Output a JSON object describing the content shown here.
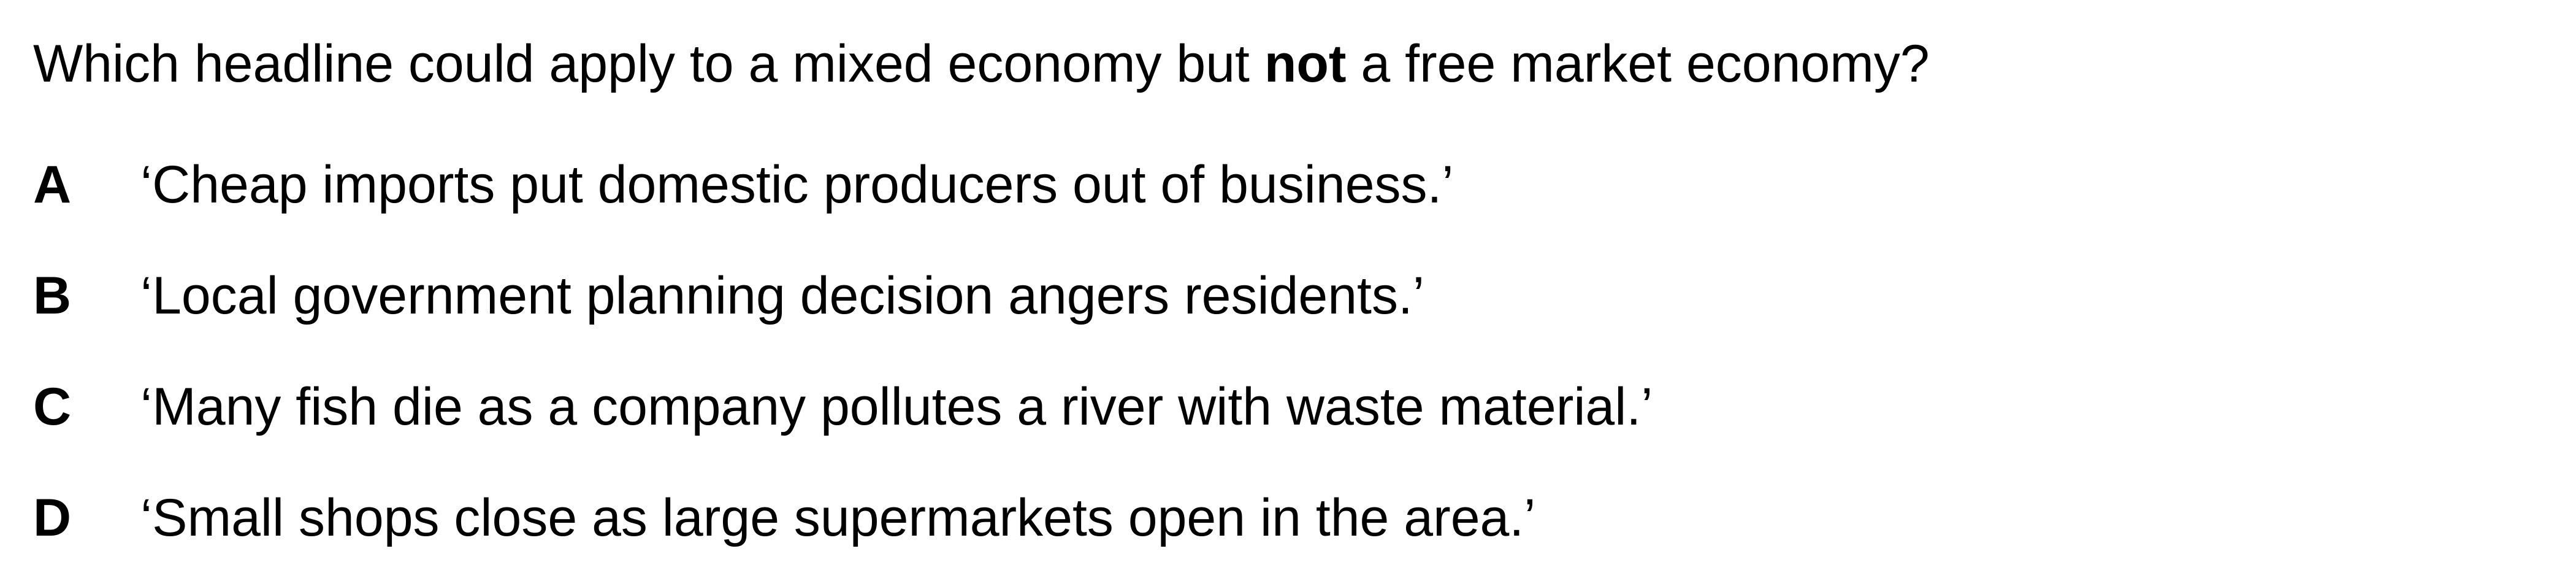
{
  "question": {
    "prefix": "Which headline could apply to a mixed economy but ",
    "emphasis": "not",
    "suffix": " a free market economy?"
  },
  "options": [
    {
      "letter": "A",
      "text": "‘Cheap imports put domestic producers out of business.’"
    },
    {
      "letter": "B",
      "text": "‘Local government planning decision angers residents.’"
    },
    {
      "letter": "C",
      "text": "‘Many fish die as a company pollutes a river with waste material.’"
    },
    {
      "letter": "D",
      "text": "‘Small shops close as large supermarkets open in the area.’"
    }
  ]
}
